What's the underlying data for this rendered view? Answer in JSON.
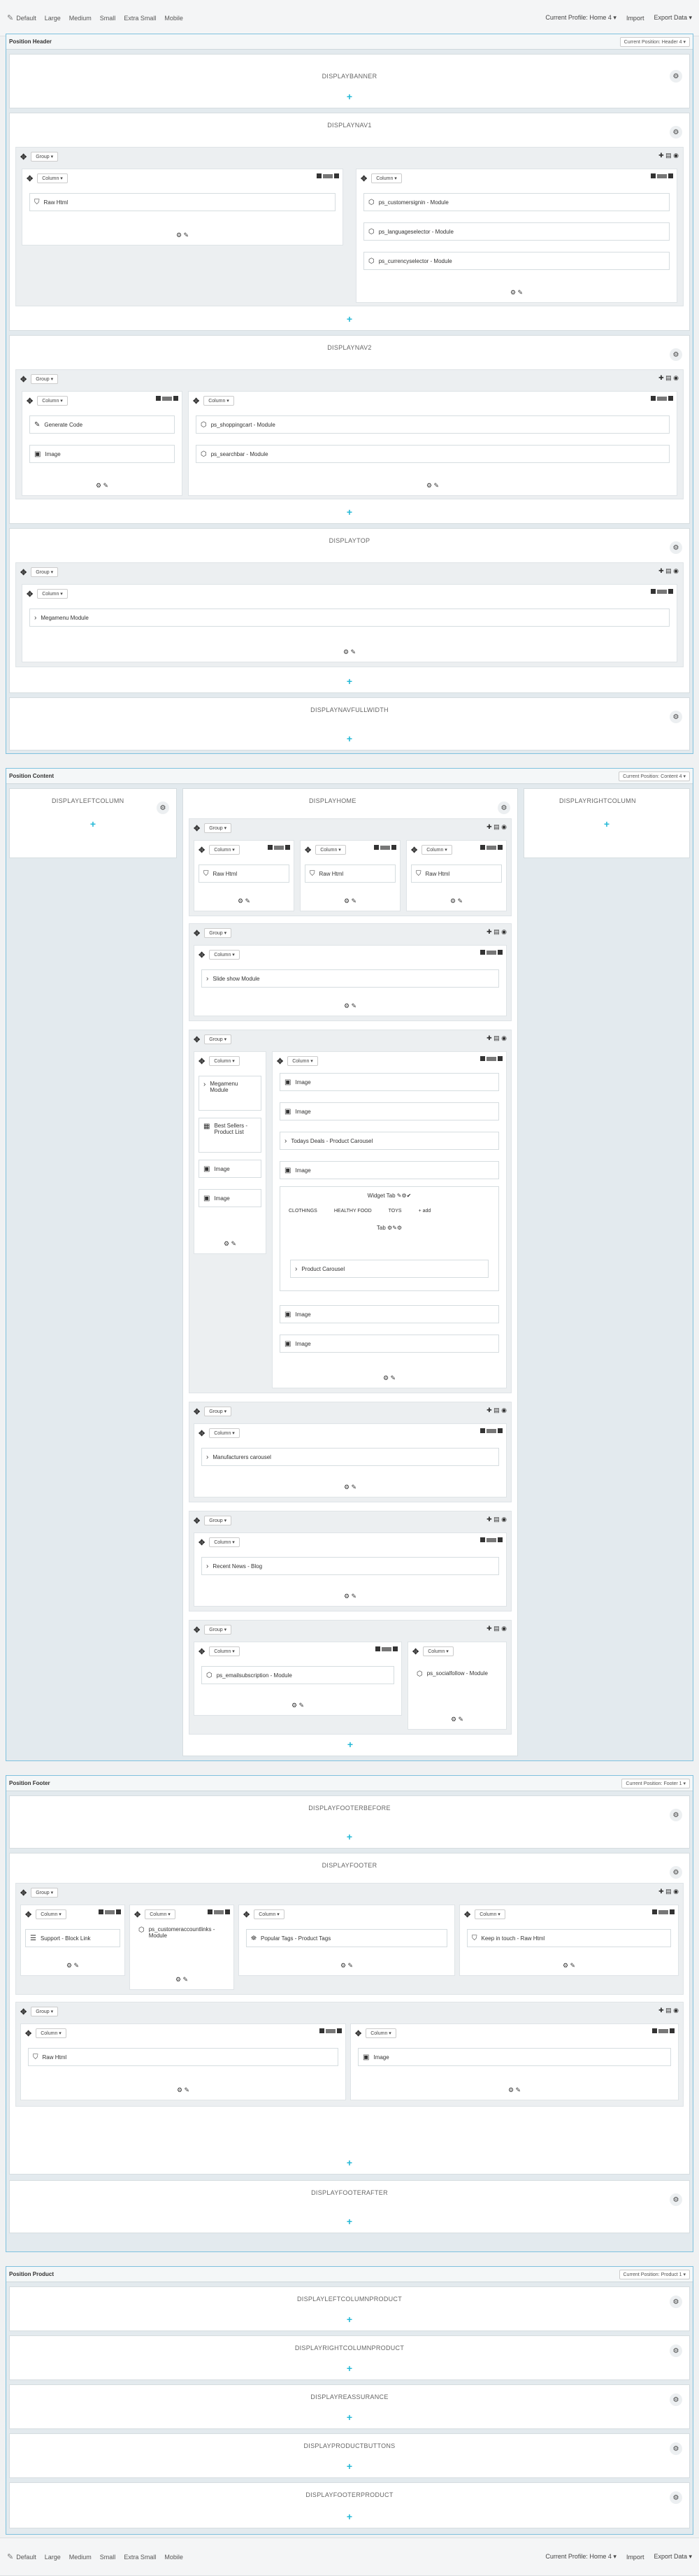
{
  "toolbar": {
    "devices": [
      "Default",
      "Large",
      "Medium",
      "Small",
      "Extra Small",
      "Mobile"
    ],
    "profile": "Current Profile: Home 4 ▾",
    "import": "Import",
    "export": "Export Data ▾"
  },
  "labels": {
    "group": "Group ▾",
    "column": "Column ▾",
    "add": "+"
  },
  "positions": {
    "header": {
      "title": "Position Header",
      "select": "Current Position: Header 4 ▾"
    },
    "content": {
      "title": "Position Content",
      "select": "Current Position: Content 4 ▾"
    },
    "footer": {
      "title": "Position Footer",
      "select": "Current Position: Footer 1 ▾"
    },
    "product": {
      "title": "Position Product",
      "select": "Current Position: Product 1 ▾"
    }
  },
  "hooks": {
    "banner": "DISPLAYBANNER",
    "nav1": "DISPLAYNAV1",
    "nav2": "DISPLAYNAV2",
    "top": "DISPLAYTOP",
    "navfull": "DISPLAYNAVFULLWIDTH",
    "left": "DISPLAYLEFTCOLUMN",
    "home": "DISPLAYHOME",
    "right": "DISPLAYRIGHTCOLUMN",
    "footbefore": "DISPLAYFOOTERBEFORE",
    "footer": "DISPLAYFOOTER",
    "footafter": "DISPLAYFOOTERAFTER",
    "leftprod": "DISPLAYLEFTCOLUMNPRODUCT",
    "rightprod": "DISPLAYRIGHTCOLUMNPRODUCT",
    "reassurance": "DISPLAYREASSURANCE",
    "prodbtn": "DISPLAYPRODUCTBUTTONS",
    "footprod": "DISPLAYFOOTERPRODUCT"
  },
  "modules": {
    "raw": "Raw Html",
    "customersignin": "ps_customersignin - Module",
    "language": "ps_languageselector - Module",
    "currency": "ps_currencyselector - Module",
    "gencode": "Generate Code",
    "image": "Image",
    "cart": "ps_shoppingcart - Module",
    "search": "ps_searchbar - Module",
    "megamenu": "Megamenu Module",
    "slideshow": "Slide show Module",
    "megamenu2": "Megamenu Module",
    "bestsellers": "Best Sellers - Product List",
    "todaydeals": "Todays Deals - Product Carousel",
    "widgettab": "Widget Tab",
    "tab1": "CLOTHINGS",
    "tab2": "HEALTHY FOOD",
    "tab3": "TOYS",
    "addtab": "+ add",
    "tab": "Tab",
    "prodcarousel": "Product Carousel",
    "manufacturers": "Manufacturers carousel",
    "blog": "Recent News - Blog",
    "email": "ps_emailsubscription - Module",
    "social": "ps_socialfollow - Module",
    "support": "Support - Block Link",
    "account": "ps_customeraccountlinks - Module",
    "tags": "Popular Tags - Product Tags",
    "keep": "Keep in touch - Raw Html"
  }
}
